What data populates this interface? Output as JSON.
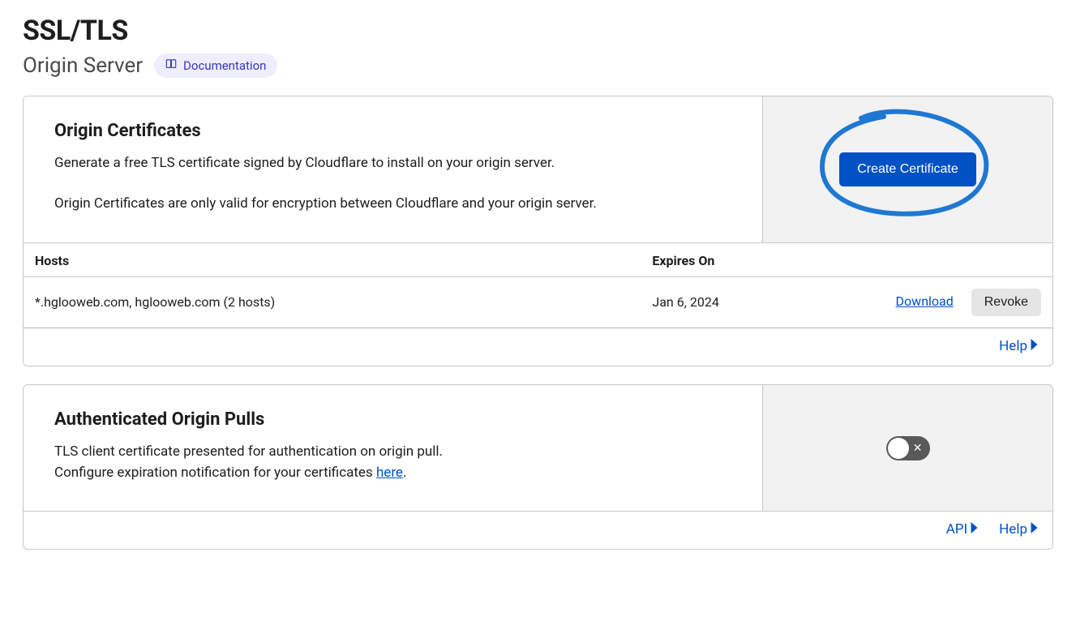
{
  "header": {
    "title": "SSL/TLS",
    "subtitle": "Origin Server",
    "doc_label": "Documentation"
  },
  "origin_certs": {
    "title": "Origin Certificates",
    "desc1": "Generate a free TLS certificate signed by Cloudflare to install on your origin server.",
    "desc2": "Origin Certificates are only valid for encryption between Cloudflare and your origin server.",
    "create_label": "Create Certificate",
    "columns": {
      "hosts": "Hosts",
      "expires": "Expires On"
    },
    "rows": [
      {
        "hosts": "*.hglooweb.com, hglooweb.com (2 hosts)",
        "expires": "Jan 6, 2024",
        "download_label": "Download",
        "revoke_label": "Revoke"
      }
    ],
    "help_label": "Help"
  },
  "auth_pulls": {
    "title": "Authenticated Origin Pulls",
    "desc_line1": "TLS client certificate presented for authentication on origin pull.",
    "desc_line2_prefix": "Configure expiration notification for your certificates ",
    "desc_line2_link": "here",
    "desc_line2_suffix": ".",
    "api_label": "API",
    "help_label": "Help",
    "toggle_state": "off"
  }
}
